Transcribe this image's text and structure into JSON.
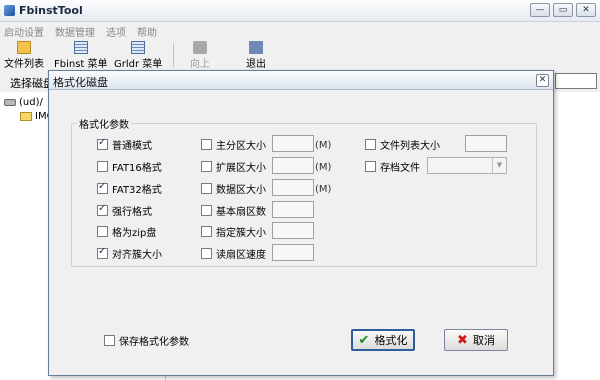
{
  "window": {
    "title": "FbinstTool"
  },
  "menu": [
    "启动设置",
    "数据管理",
    "选项",
    "帮助"
  ],
  "toolbar": {
    "file_list": "文件列表",
    "fbinst_menu": "Fbinst 菜单",
    "grldr_menu": "Grldr 菜单",
    "up": "向上",
    "exit": "退出"
  },
  "disk_bar": {
    "label": "选择磁盘"
  },
  "tree": {
    "root": "(ud)/",
    "child": "IMG"
  },
  "dialog": {
    "title": "格式化磁盘",
    "group_label": "格式化参数",
    "col1": [
      {
        "label": "普通模式",
        "checked": true
      },
      {
        "label": "FAT16格式",
        "checked": false
      },
      {
        "label": "FAT32格式",
        "checked": true
      },
      {
        "label": "强行格式",
        "checked": true
      },
      {
        "label": "格为zip盘",
        "checked": false
      },
      {
        "label": "对齐簇大小",
        "checked": true
      }
    ],
    "col2": [
      {
        "label": "主分区大小",
        "checked": false,
        "unit": "(M)"
      },
      {
        "label": "扩展区大小",
        "checked": false,
        "unit": "(M)"
      },
      {
        "label": "数据区大小",
        "checked": false,
        "unit": "(M)"
      },
      {
        "label": "基本扇区数",
        "checked": false,
        "unit": ""
      },
      {
        "label": "指定簇大小",
        "checked": false,
        "unit": ""
      },
      {
        "label": "读扇区速度",
        "checked": false,
        "unit": ""
      }
    ],
    "col3": [
      {
        "label": "文件列表大小",
        "checked": false
      },
      {
        "label": "存档文件",
        "checked": false
      }
    ],
    "save_params": "保存格式化参数",
    "format_button": "格式化",
    "cancel_button": "取消"
  }
}
